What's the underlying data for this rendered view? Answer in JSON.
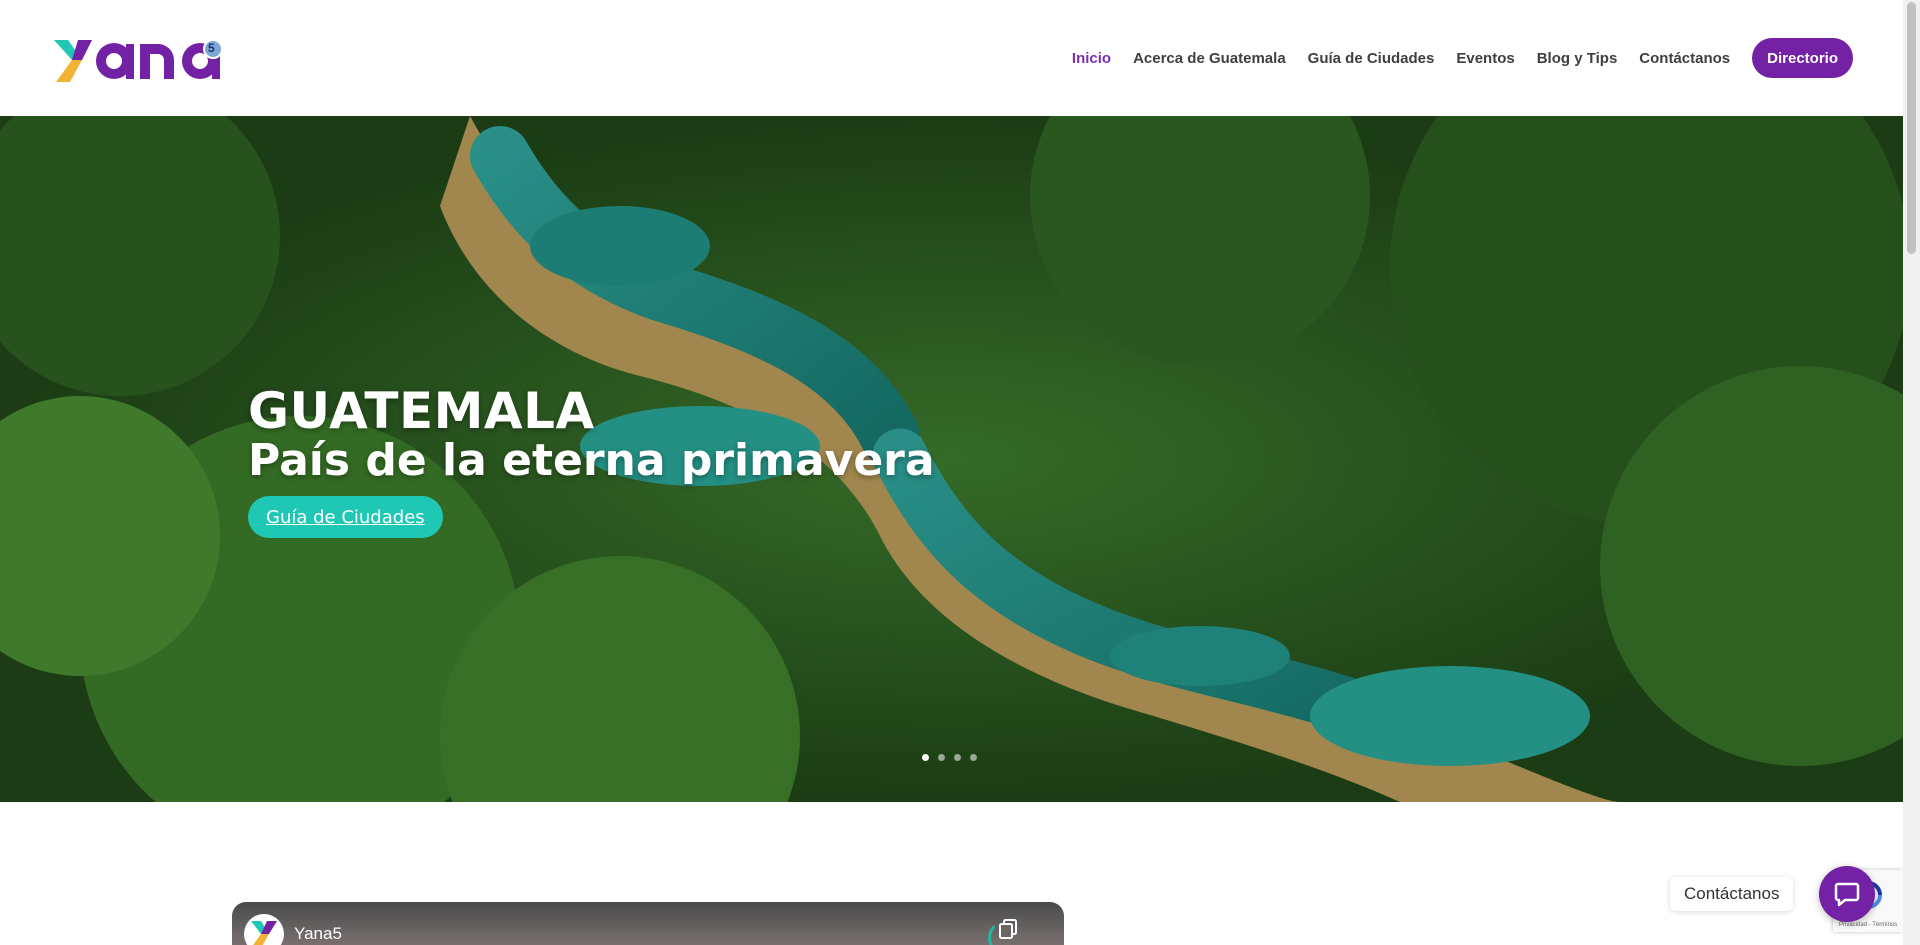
{
  "brand": {
    "logo_text": "yana",
    "logo_badge": "5",
    "colors": {
      "purple": "#7321a5",
      "purple_active": "#7b2fb0",
      "teal": "#1ec8b4",
      "yellow": "#f2b233"
    }
  },
  "nav": {
    "items": [
      {
        "label": "Inicio",
        "active": true
      },
      {
        "label": "Acerca de Guatemala",
        "active": false
      },
      {
        "label": "Guía de Ciudades",
        "active": false
      },
      {
        "label": "Eventos",
        "active": false
      },
      {
        "label": "Blog y Tips",
        "active": false
      },
      {
        "label": "Contáctanos",
        "active": false
      }
    ],
    "cta_label": "Directorio"
  },
  "hero": {
    "title": "GUATEMALA",
    "subtitle": "País de la eterna primavera",
    "button_label": "Guía de Ciudades",
    "slides_total": 4,
    "active_slide": 1
  },
  "video": {
    "channel_name": "Yana5",
    "copy_icon": "copy-icon"
  },
  "floating_contact": {
    "label": "Contáctanos",
    "icon": "chat-icon"
  },
  "recaptcha": {
    "text": "Privacidad - Términos"
  }
}
